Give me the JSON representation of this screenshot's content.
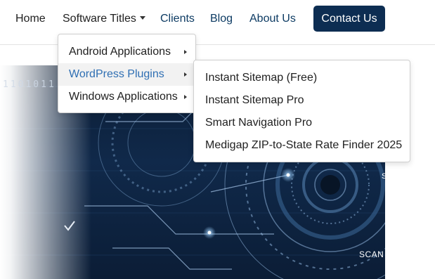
{
  "nav": {
    "home": "Home",
    "software_titles": "Software Titles",
    "clients": "Clients",
    "blog": "Blog",
    "about": "About Us",
    "contact": "Contact Us"
  },
  "software_menu": {
    "items": [
      {
        "label": "Android Applications",
        "has_submenu": true,
        "active": false
      },
      {
        "label": "WordPress Plugins",
        "has_submenu": true,
        "active": true
      },
      {
        "label": "Windows Applications",
        "has_submenu": true,
        "active": false
      }
    ]
  },
  "wordpress_submenu": {
    "items": [
      {
        "label": "Instant Sitemap (Free)"
      },
      {
        "label": "Instant Sitemap Pro"
      },
      {
        "label": "Smart Navigation Pro"
      },
      {
        "label": "Medigap ZIP-to-State Rate Finder 2025"
      }
    ]
  },
  "hero": {
    "binary_text": "1101011",
    "scan_text": "SCAN",
    "edge_text": "S"
  },
  "colors": {
    "nav_link": "#0d3b63",
    "contact_bg": "#0d2d52",
    "active_menu_text": "#2f6fb3"
  }
}
